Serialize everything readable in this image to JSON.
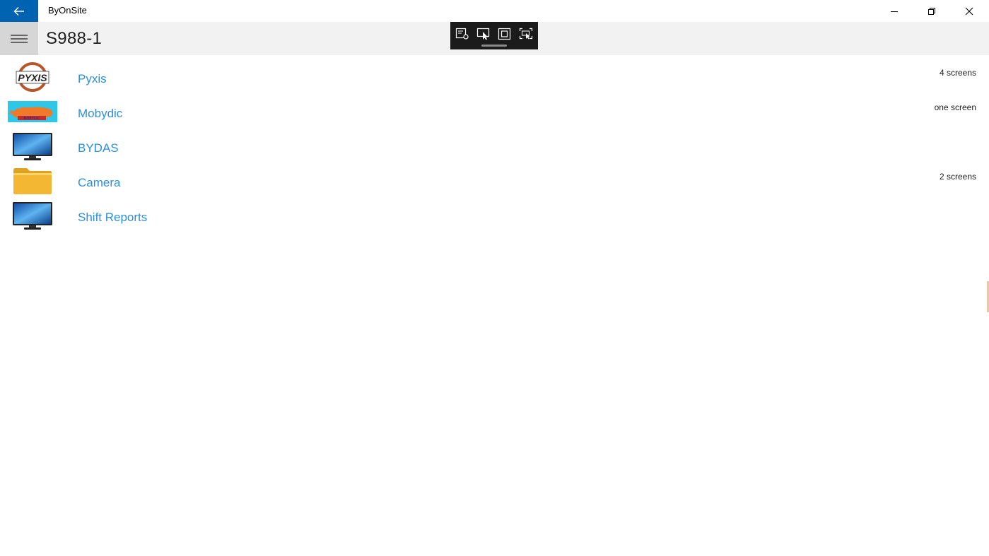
{
  "window": {
    "app_title": "ByOnSite",
    "back_icon": "arrow-left-icon",
    "minimize_icon": "minimize-icon",
    "restore_icon": "restore-icon",
    "close_icon": "close-icon"
  },
  "header": {
    "menu_icon": "hamburger-icon",
    "title": "S988-1"
  },
  "debug_toolbar": {
    "tools": [
      "live-visual-tree-icon",
      "select-element-icon",
      "display-layout-adorners-icon",
      "track-focused-element-icon"
    ]
  },
  "list": {
    "items": [
      {
        "label": "Pyxis",
        "meta": "4 screens",
        "icon": "pyxis-logo-icon"
      },
      {
        "label": "Mobydic",
        "meta": "one screen",
        "icon": "mobydic-whale-icon"
      },
      {
        "label": "BYDAS",
        "meta": "",
        "icon": "monitor-icon"
      },
      {
        "label": "Camera",
        "meta": "2 screens",
        "icon": "folder-icon"
      },
      {
        "label": "Shift Reports",
        "meta": "",
        "icon": "monitor-icon"
      }
    ]
  },
  "colors": {
    "accent": "#0063b1",
    "link": "#2e8fd9",
    "header_bg": "#f2f2f2",
    "toolbar_bg": "#1b1b1b"
  }
}
